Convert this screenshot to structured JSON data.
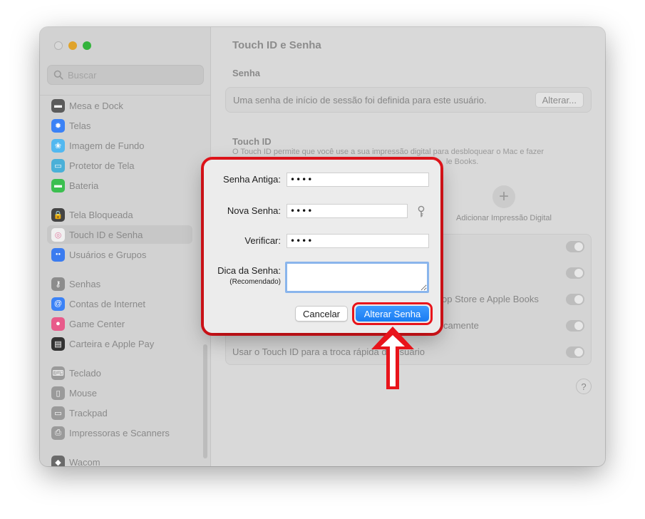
{
  "window": {
    "title": "Touch ID e Senha"
  },
  "sidebar": {
    "search_placeholder": "Buscar",
    "items": [
      {
        "label": "Mesa e Dock",
        "icon": "dock-icon",
        "color": "#5b5b5b"
      },
      {
        "label": "Telas",
        "icon": "sun-icon",
        "color": "#3b82f6"
      },
      {
        "label": "Imagem de Fundo",
        "icon": "flower-icon",
        "color": "#52b8f0"
      },
      {
        "label": "Protetor de Tela",
        "icon": "screensaver-icon",
        "color": "#4ab0d8"
      },
      {
        "label": "Bateria",
        "icon": "battery-icon",
        "color": "#3cbf50"
      },
      {
        "label": "Tela Bloqueada",
        "icon": "lock-icon",
        "color": "#444444"
      },
      {
        "label": "Touch ID e Senha",
        "icon": "fingerprint-icon",
        "color": "#f0f0f0",
        "selected": true
      },
      {
        "label": "Usuários e Grupos",
        "icon": "users-icon",
        "color": "#3b7cf0"
      },
      {
        "label": "Senhas",
        "icon": "key-icon",
        "color": "#8c8c8c"
      },
      {
        "label": "Contas de Internet",
        "icon": "at-icon",
        "color": "#3b82f6"
      },
      {
        "label": "Game Center",
        "icon": "game-center-icon",
        "color": "#e85a8a"
      },
      {
        "label": "Carteira e Apple Pay",
        "icon": "wallet-icon",
        "color": "#333333"
      },
      {
        "label": "Teclado",
        "icon": "keyboard-icon",
        "color": "#9a9a9a"
      },
      {
        "label": "Mouse",
        "icon": "mouse-icon",
        "color": "#9a9a9a"
      },
      {
        "label": "Trackpad",
        "icon": "trackpad-icon",
        "color": "#9a9a9a"
      },
      {
        "label": "Impressoras e Scanners",
        "icon": "printer-icon",
        "color": "#9a9a9a"
      },
      {
        "label": "Wacom",
        "icon": "wacom-icon",
        "color": "#6a6a6a"
      }
    ]
  },
  "main": {
    "password_section": "Senha",
    "password_status": "Uma senha de início de sessão foi definida para este usuário.",
    "change_button": "Alterar...",
    "touchid_section": "Touch ID",
    "touchid_description_line1": "O Touch ID permite que você use a sua impressão digital para desbloquear o Mac e fazer",
    "touchid_description_line2": "le Books.",
    "add_fingerprint": "Adicionar Impressão Digital",
    "toggles": [
      {
        "label": "",
        "on": false
      },
      {
        "label": "",
        "on": false
      },
      {
        "label": "op Store e Apple Books",
        "on": false
      },
      {
        "label": "camente",
        "on": false
      },
      {
        "label": "Usar o Touch ID para a troca rápida de usuário",
        "on": false
      }
    ],
    "help": "?"
  },
  "dialog": {
    "old_password_label": "Senha Antiga:",
    "old_password_value": "••••",
    "new_password_label": "Nova Senha:",
    "new_password_value": "••••",
    "verify_label": "Verificar:",
    "verify_value": "••••",
    "hint_label": "Dica da Senha:",
    "hint_sub": "(Recomendado)",
    "hint_value": "",
    "cancel_button": "Cancelar",
    "confirm_button": "Alterar Senha"
  },
  "colors": {
    "highlight": "#e8141b",
    "primary_button": "#1a7cf2",
    "focus_ring": "#8ab5ec"
  }
}
